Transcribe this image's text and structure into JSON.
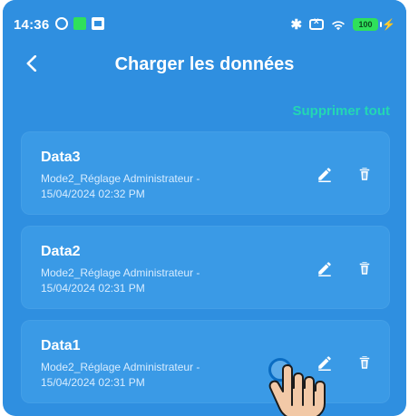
{
  "statusbar": {
    "time": "14:36",
    "battery": "100",
    "colors": {
      "bg": "#2f8fe0",
      "battery": "#2fe05b"
    },
    "icons": [
      "gear-off-icon",
      "green-app-icon",
      "image-app-icon",
      "bluetooth-icon",
      "sim-icon",
      "wifi-icon",
      "battery-icon",
      "charging-bolt-icon"
    ]
  },
  "header": {
    "title": "Charger les données",
    "back_icon": "chevron-left-icon"
  },
  "actions": {
    "delete_all_label": "Supprimer tout",
    "accent": "#23d7b3"
  },
  "items": [
    {
      "name": "Data3",
      "line1": "Mode2_Réglage Administrateur -",
      "line2": "15/04/2024 02:32 PM",
      "edit_icon": "pencil-icon",
      "delete_icon": "trash-icon"
    },
    {
      "name": "Data2",
      "line1": "Mode2_Réglage Administrateur -",
      "line2": "15/04/2024 02:31 PM",
      "edit_icon": "pencil-icon",
      "delete_icon": "trash-icon"
    },
    {
      "name": "Data1",
      "line1": "Mode2_Réglage Administrateur -",
      "line2": "15/04/2024 02:31 PM",
      "edit_icon": "pencil-icon",
      "delete_icon": "trash-icon"
    }
  ]
}
